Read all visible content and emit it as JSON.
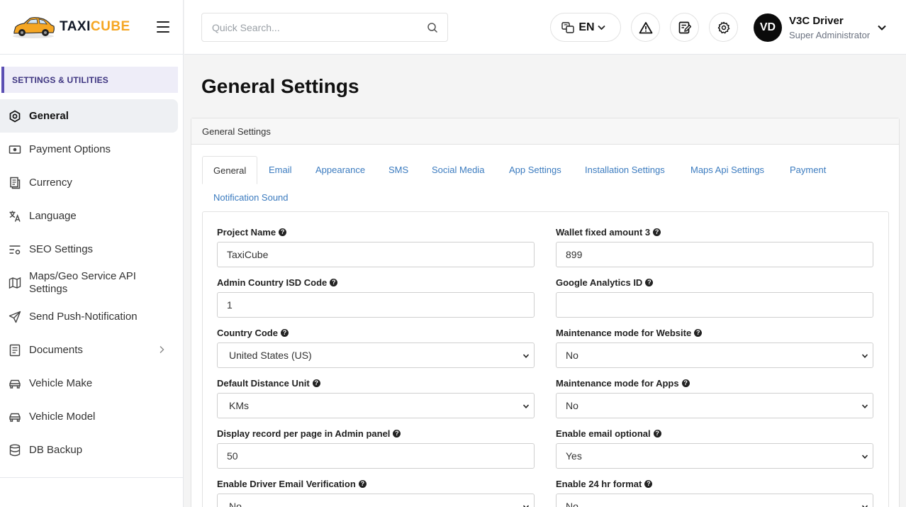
{
  "brand": {
    "part1": "TAXI",
    "part2": "CUBE"
  },
  "sidebar": {
    "section": "SETTINGS & UTILITIES",
    "items": [
      {
        "label": "General",
        "icon": "hexagon-gear-icon"
      },
      {
        "label": "Payment Options",
        "icon": "cash-icon"
      },
      {
        "label": "Currency",
        "icon": "receipt-icon"
      },
      {
        "label": "Language",
        "icon": "translate-icon"
      },
      {
        "label": "SEO Settings",
        "icon": "seo-settings-icon"
      },
      {
        "label": "Maps/Geo Service API Settings",
        "icon": "map-icon"
      },
      {
        "label": "Send Push-Notification",
        "icon": "send-icon"
      },
      {
        "label": "Documents",
        "icon": "document-icon"
      },
      {
        "label": "Vehicle Make",
        "icon": "car-icon"
      },
      {
        "label": "Vehicle Model",
        "icon": "car-icon"
      },
      {
        "label": "DB Backup",
        "icon": "database-icon"
      }
    ]
  },
  "header": {
    "search_placeholder": "Quick Search...",
    "lang": "EN",
    "user": {
      "initials": "VD",
      "name": "V3C Driver",
      "role": "Super Administrator"
    }
  },
  "main": {
    "title": "General Settings",
    "card_title": "General Settings",
    "tabs": [
      "General",
      "Email",
      "Appearance",
      "SMS",
      "Social Media",
      "App Settings",
      "Installation Settings",
      "Maps Api Settings",
      "Payment",
      "Notification Sound"
    ],
    "fields_left": [
      {
        "label": "Project Name",
        "value": "TaxiCube",
        "type": "input"
      },
      {
        "label": "Admin Country ISD Code",
        "value": "1",
        "type": "input"
      },
      {
        "label": "Country Code",
        "value": "United States (US)",
        "type": "select"
      },
      {
        "label": "Default Distance Unit",
        "value": "KMs",
        "type": "select"
      },
      {
        "label": "Display record per page in Admin panel",
        "value": "50",
        "type": "input"
      },
      {
        "label": "Enable Driver Email Verification",
        "value": "No",
        "type": "select"
      }
    ],
    "fields_right": [
      {
        "label": "Wallet fixed amount 3",
        "value": "899",
        "type": "input"
      },
      {
        "label": "Google Analytics ID",
        "value": "",
        "type": "input"
      },
      {
        "label": "Maintenance mode for Website",
        "value": "No",
        "type": "select"
      },
      {
        "label": "Maintenance mode for Apps",
        "value": "No",
        "type": "select"
      },
      {
        "label": "Enable email optional",
        "value": "Yes",
        "type": "select"
      },
      {
        "label": "Enable 24 hr format",
        "value": "No",
        "type": "select"
      }
    ]
  },
  "colors": {
    "accent": "#5b4fb3",
    "brand_orange": "#f5a623",
    "link": "#3b7bbf"
  }
}
